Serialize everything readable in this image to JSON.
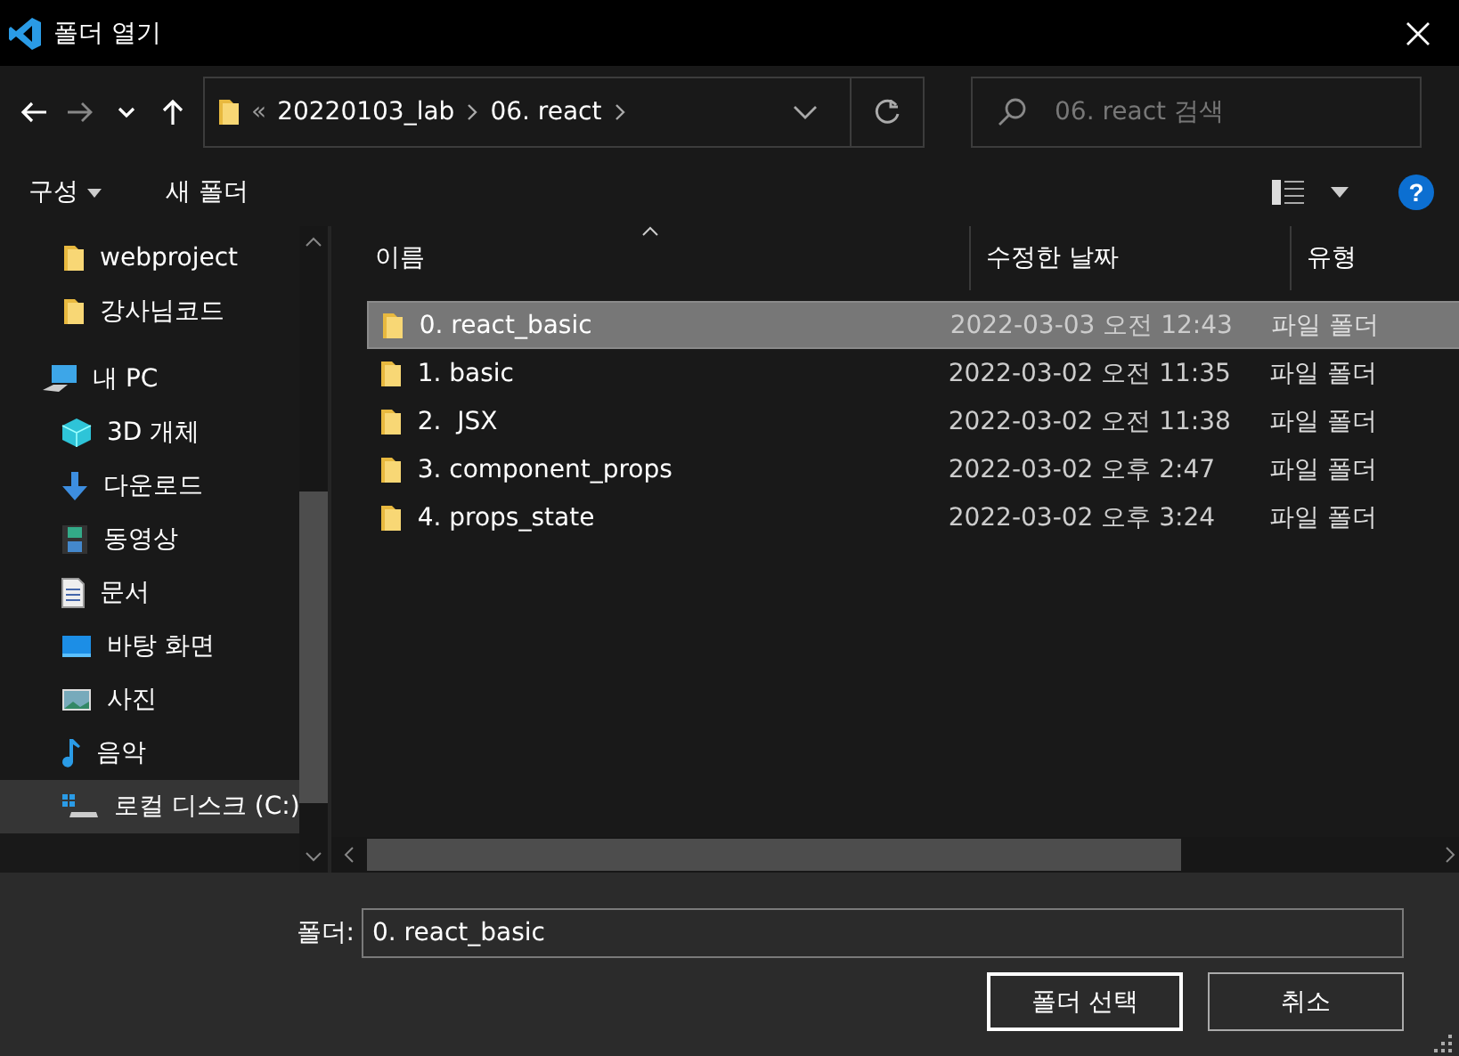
{
  "window": {
    "title": "폴더 열기"
  },
  "address": {
    "overflow": "«",
    "segments": [
      "20220103_lab",
      "06. react"
    ]
  },
  "search": {
    "placeholder": "06. react 검색"
  },
  "toolbar": {
    "organize": "구성",
    "new_folder": "새 폴더",
    "help": "?"
  },
  "sidebar": {
    "items": [
      {
        "label": "webproject",
        "kind": "folder",
        "selected": false
      },
      {
        "label": "강사님코드",
        "kind": "folder",
        "selected": false
      },
      {
        "label": "내 PC",
        "kind": "pc",
        "selected": false,
        "children": [
          {
            "label": "3D 개체",
            "kind": "cube",
            "selected": false
          },
          {
            "label": "다운로드",
            "kind": "download",
            "selected": false
          },
          {
            "label": "동영상",
            "kind": "video",
            "selected": false
          },
          {
            "label": "문서",
            "kind": "document",
            "selected": false
          },
          {
            "label": "바탕 화면",
            "kind": "desktop",
            "selected": false
          },
          {
            "label": "사진",
            "kind": "picture",
            "selected": false
          },
          {
            "label": "음악",
            "kind": "music",
            "selected": false
          },
          {
            "label": "로컬 디스크 (C:)",
            "kind": "drive",
            "selected": true
          }
        ]
      }
    ]
  },
  "table": {
    "columns": [
      "이름",
      "수정한 날짜",
      "유형"
    ],
    "rows": [
      {
        "name": "0. react_basic",
        "date": "2022-03-03 오전 12:43",
        "type": "파일 폴더",
        "selected": true
      },
      {
        "name": "1. basic",
        "date": "2022-03-02 오전 11:35",
        "type": "파일 폴더",
        "selected": false
      },
      {
        "name": "2.  JSX",
        "date": "2022-03-02 오전 11:38",
        "type": "파일 폴더",
        "selected": false
      },
      {
        "name": "3. component_props",
        "date": "2022-03-02 오후 2:47",
        "type": "파일 폴더",
        "selected": false
      },
      {
        "name": "4. props_state",
        "date": "2022-03-02 오후 3:24",
        "type": "파일 폴더",
        "selected": false
      }
    ]
  },
  "footer": {
    "label": "폴더:",
    "value": "0. react_basic",
    "buttons": [
      "폴더 선택",
      "취소"
    ]
  }
}
